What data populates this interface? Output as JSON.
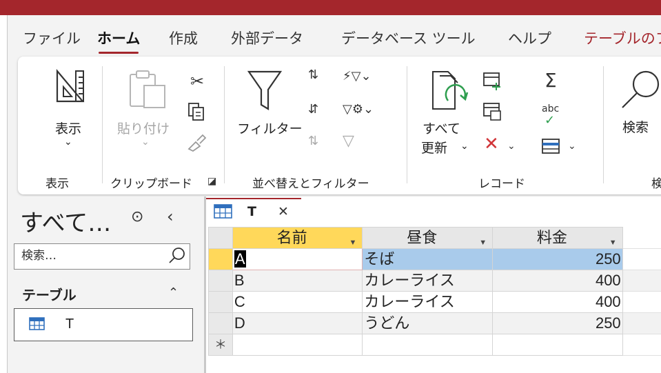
{
  "menu": {
    "tabs": [
      "ファイル",
      "ホーム",
      "作成",
      "外部データ",
      "データベース ツール",
      "ヘルプ",
      "テーブルのフ"
    ],
    "active_tab": "ホーム"
  },
  "ribbon": {
    "view": {
      "label": "表示",
      "group": "表示"
    },
    "clipboard": {
      "paste": "貼り付け",
      "group": "クリップボード"
    },
    "sort_filter": {
      "filter": "フィルター",
      "group": "並べ替えとフィルター"
    },
    "records": {
      "refresh_line1": "すべて",
      "refresh_line2": "更新",
      "sum_label": "abc",
      "group": "レコード"
    },
    "find": {
      "search": "検索",
      "group": "検"
    }
  },
  "nav": {
    "title": "すべて…",
    "search_placeholder": "検索…",
    "category": "テーブル",
    "items": [
      "T"
    ]
  },
  "doc_tab": {
    "label": "T",
    "close": "✕"
  },
  "grid": {
    "columns": [
      "名前",
      "昼食",
      "料金"
    ],
    "rows": [
      {
        "name": "A",
        "lunch": "そば",
        "price": "250"
      },
      {
        "name": "B",
        "lunch": "カレーライス",
        "price": "400"
      },
      {
        "name": "C",
        "lunch": "カレーライス",
        "price": "400"
      },
      {
        "name": "D",
        "lunch": "うどん",
        "price": "250"
      }
    ],
    "new_row_marker": "＊"
  },
  "colors": {
    "accent": "#a4262c",
    "selected_column": "#ffd85a",
    "selected_cells": "#a9cbeb"
  }
}
